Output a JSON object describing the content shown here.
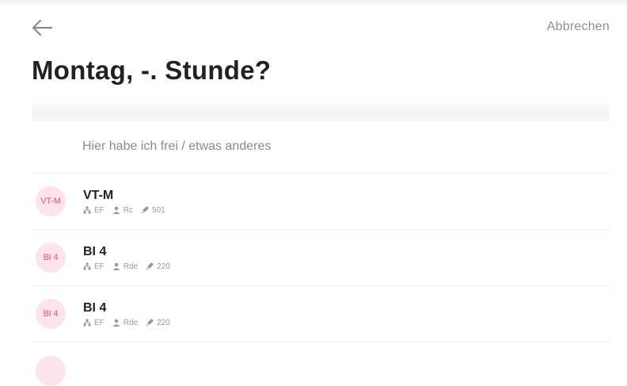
{
  "header": {
    "cancel_label": "Abbrechen",
    "title": "Montag, -. Stunde?"
  },
  "options": {
    "free_label": "Hier habe ich frei / etwas anderes"
  },
  "lessons": [
    {
      "badge": "VT-M",
      "name": "VT-M",
      "course": "EF",
      "teacher": "Rc",
      "room": "501"
    },
    {
      "badge": "BI 4",
      "name": "BI 4",
      "course": "EF",
      "teacher": "Rde",
      "room": "220"
    },
    {
      "badge": "BI 4",
      "name": "BI 4",
      "course": "EF",
      "teacher": "Rde",
      "room": "220"
    }
  ],
  "colors": {
    "accent": "#e8507f",
    "badge_bg": "#fde4ec"
  },
  "icons": [
    "back-arrow-icon",
    "course-icon",
    "teacher-icon",
    "room-icon"
  ]
}
